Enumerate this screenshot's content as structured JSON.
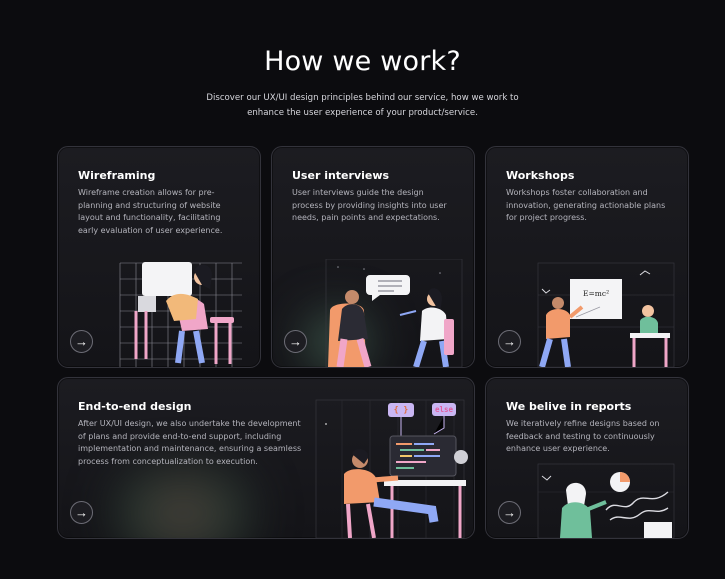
{
  "header": {
    "title": "How we work?",
    "subtitle_line1": "Discover our UX/UI design principles behind our service, how we work to",
    "subtitle_line2": "enhance the user experience of your product/service."
  },
  "cards": [
    {
      "title": "Wireframing",
      "lines": [
        "Wireframe creation allows for pre-",
        "planning and structuring of website",
        "layout and functionality, facilitating",
        "early evaluation of user experience."
      ],
      "arrow": "→"
    },
    {
      "title": "User interviews",
      "lines": [
        "User interviews guide the design",
        "process by providing insights into user",
        "needs, pain points and expectations."
      ],
      "arrow": "→"
    },
    {
      "title": "Workshops",
      "lines": [
        "Workshops foster collaboration and",
        "innovation, generating actionable plans",
        "for project progress."
      ],
      "arrow": "→",
      "board_text": "E=mc²"
    },
    {
      "title": "End-to-end design",
      "lines": [
        "After UX/UI design, we also undertake the development",
        "of plans and provide end-to-end support, including",
        "implementation and maintenance, ensuring a seamless",
        "process from conceptualization to execution."
      ],
      "arrow": "→",
      "tag_code": "{ }",
      "tag_else": "else"
    },
    {
      "title": "We belive in reports",
      "lines": [
        "We iteratively refine designs based on",
        "feedback and testing to continuously",
        "enhance user experience."
      ],
      "arrow": "→"
    }
  ],
  "colors": {
    "background": "#0c0c0f",
    "card_border": "#33333b",
    "accent_pink": "#f0a6c8",
    "accent_orange": "#f29a6b",
    "accent_blue": "#8fa8f5",
    "accent_green": "#6fbf9b"
  }
}
